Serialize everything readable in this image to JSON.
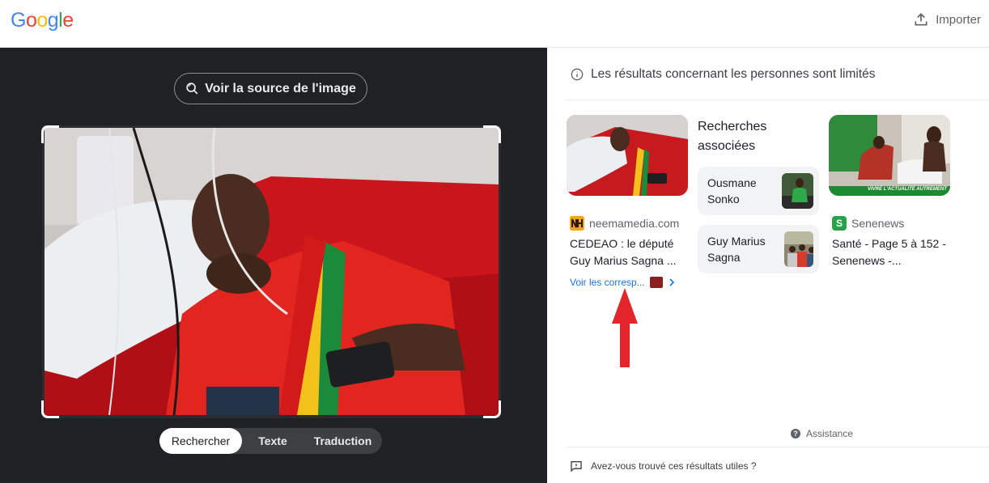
{
  "header": {
    "logo_letters": [
      {
        "ch": "G",
        "color": "#4285F4"
      },
      {
        "ch": "o",
        "color": "#EA4335"
      },
      {
        "ch": "o",
        "color": "#FBBC05"
      },
      {
        "ch": "g",
        "color": "#4285F4"
      },
      {
        "ch": "l",
        "color": "#34A853"
      },
      {
        "ch": "e",
        "color": "#EA4335"
      }
    ],
    "upload_label": "Importer"
  },
  "viewer": {
    "source_button": "Voir la source de l'image",
    "modes": [
      "Rechercher",
      "Texte",
      "Traduction"
    ],
    "active_mode": "Rechercher"
  },
  "results": {
    "notice": "Les résultats concernant les personnes sont limités",
    "card1": {
      "source": "neemamedia.com",
      "title": "CEDEAO : le député Guy Marius Sagna ...",
      "more_link": "Voir les corresp..."
    },
    "related": {
      "heading": "Recherches associées",
      "items": [
        "Ousmane Sonko",
        "Guy Marius Sagna"
      ]
    },
    "card2": {
      "source": "Senenews",
      "title": "Santé - Page 5 à 152 - Senenews -...",
      "banner_text": "VIVRE L'ACTUALITE AUTREMENT"
    },
    "assistance": "Assistance",
    "feedback": "Avez-vous trouvé ces résultats utiles ?"
  },
  "colors": {
    "accent_link": "#1a73e8",
    "dark_bg": "#202124",
    "annotation_arrow": "#e3262b"
  }
}
